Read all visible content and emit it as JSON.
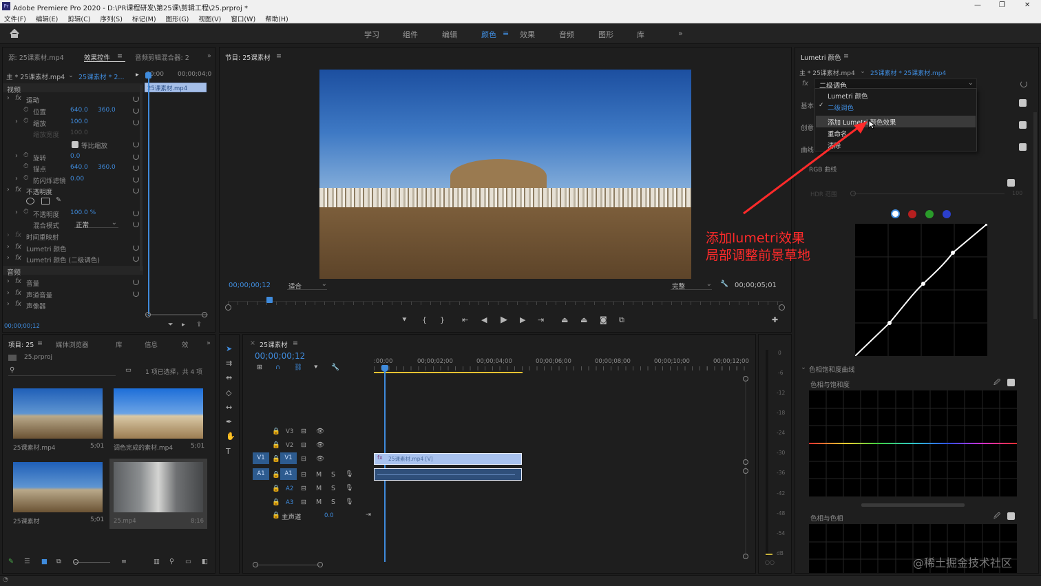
{
  "window": {
    "title": "Adobe Premiere Pro 2020 - D:\\PR课程研发\\第25课\\剪辑工程\\25.prproj *",
    "controls": [
      "—",
      "❐",
      "✕"
    ]
  },
  "menu": [
    "文件(F)",
    "编辑(E)",
    "剪辑(C)",
    "序列(S)",
    "标记(M)",
    "图形(G)",
    "视图(V)",
    "窗口(W)",
    "帮助(H)"
  ],
  "workspaces": [
    "学习",
    "组件",
    "编辑",
    "颜色",
    "效果",
    "音频",
    "图形",
    "库"
  ],
  "workspace_active": "颜色",
  "effect_panel": {
    "tabs": [
      "源: 25课素材.mp4",
      "效果控件",
      "音频剪辑混合器: 2"
    ],
    "active_tab": "效果控件",
    "master": "主 * 25课素材.mp4",
    "clip": "25课素材 * 2...",
    "time_start": "00:00",
    "time_end": "00;00;04;0",
    "clip_bar": "25课素材.mp4",
    "video_label": "视频",
    "rows": [
      {
        "label": "运动",
        "type": "fx"
      },
      {
        "label": "位置",
        "v1": "640.0",
        "v2": "360.0"
      },
      {
        "label": "缩放",
        "v1": "100.0"
      },
      {
        "label": "缩放宽度",
        "v1": "100.0",
        "dim": true
      },
      {
        "label": "等比缩放",
        "type": "checkbox"
      },
      {
        "label": "旋转",
        "v1": "0.0"
      },
      {
        "label": "锚点",
        "v1": "640.0",
        "v2": "360.0"
      },
      {
        "label": "防闪烁滤镜",
        "v1": "0.00"
      },
      {
        "label": "不透明度",
        "type": "fx"
      },
      {
        "label": "",
        "type": "masks"
      },
      {
        "label": "不透明度",
        "v1": "100.0 %"
      },
      {
        "label": "混合模式",
        "v1": "正常",
        "type": "select"
      },
      {
        "label": "时间重映射",
        "type": "fx"
      },
      {
        "label": "Lumetri 颜色",
        "type": "fx"
      },
      {
        "label": "Lumetri 颜色 (二级调色)",
        "type": "fx"
      }
    ],
    "audio_label": "音频",
    "audio_rows": [
      "音量",
      "声道音量",
      "声像器"
    ],
    "timecode": "00;00;00;12"
  },
  "program": {
    "title": "节目: 25课素材",
    "timecode": "00;00;00;12",
    "fit": "适合",
    "quality": "完整",
    "duration": "00;00;05;01"
  },
  "project": {
    "tabs": [
      "项目: 25",
      "媒体浏览器",
      "库",
      "信息",
      "效"
    ],
    "file": "25.prproj",
    "selection": "1 项已选择，共 4 项",
    "items": [
      {
        "name": "25课素材.mp4",
        "dur": "5;01"
      },
      {
        "name": "调色完成的素材.mp4",
        "dur": "5;01"
      },
      {
        "name": "25课素材",
        "dur": "5;01"
      },
      {
        "name": "25.mp4",
        "dur": "8;16"
      }
    ]
  },
  "timeline": {
    "title": "25课素材",
    "timecode": "00;00;00;12",
    "ruler": [
      ":00;00",
      "00;00;02;00",
      "00;00;04;00",
      "00;00;06;00",
      "00;00;08;00",
      "00;00;10;00",
      "00;00;12;00"
    ],
    "video_tracks": [
      "V3",
      "V2",
      "V1"
    ],
    "audio_tracks": [
      "A1",
      "A2",
      "A3"
    ],
    "track_target_v": "V1",
    "track_target_a": "A1",
    "master_label": "主声道",
    "master_val": "0.0",
    "clip_video": "25课素材.mp4 [V]",
    "mute": "M",
    "solo": "S"
  },
  "meter": {
    "scale": [
      "0",
      "-6",
      "-12",
      "-18",
      "-24",
      "-30",
      "-36",
      "-42",
      "-48",
      "-54",
      "dB"
    ]
  },
  "lumetri": {
    "title": "Lumetri 颜色",
    "master": "主 * 25课素材.mp4",
    "clip": "25课素材 * 25课素材.mp4",
    "dropdown_value": "二级调色",
    "menu": [
      "Lumetri 颜色",
      "二级调色",
      "添加 Lumetri 颜色效果",
      "重命名",
      "清除"
    ],
    "menu_checked": "二级调色",
    "sections": [
      "基本",
      "创意",
      "曲线"
    ],
    "rgb_curve": "RGB 曲线",
    "hdr": "HDR 范围",
    "hdr_max": "100",
    "hue_sat": "色相饱和度曲线",
    "hue_vs_sat": "色相与饱和度",
    "hue_vs_hue": "色相与色相"
  },
  "annotation": {
    "line1": "添加lumetri效果",
    "line2": "局部调整前景草地",
    "color": "#ff2a2a"
  },
  "watermark": "@稀土掘金技术社区"
}
